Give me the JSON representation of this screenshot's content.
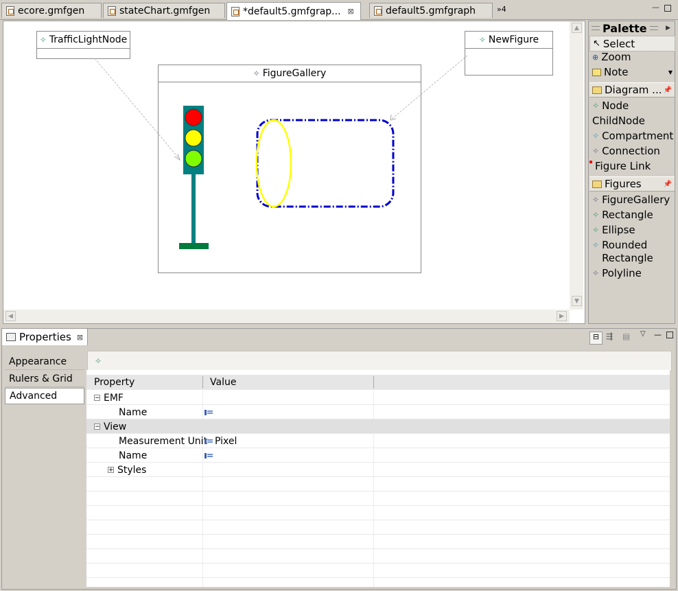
{
  "tabs": [
    {
      "label": "ecore.gmfgen"
    },
    {
      "label": "stateChart.gmfgen"
    },
    {
      "label": "*default5.gmfgrap..."
    },
    {
      "label": "default5.gmfgraph"
    }
  ],
  "overflow_count": "»4",
  "diagram": {
    "traffic_node": "TrafficLightNode",
    "new_figure": "NewFigure",
    "gallery": "FigureGallery",
    "colors": {
      "red": "#ff0000",
      "yellow": "#ffff00",
      "green": "#80ff00",
      "pole": "#008080",
      "base": "#007a3d",
      "dashed": "#0000cc",
      "ellipse": "#ffff00"
    }
  },
  "palette": {
    "title": "Palette",
    "tools": [
      {
        "label": "Select",
        "icon": "arrow-cursor-icon"
      },
      {
        "label": "Zoom",
        "icon": "magnifier-icon"
      },
      {
        "label": "Note",
        "icon": "note-icon"
      }
    ],
    "drawers": [
      {
        "label": "Diagram ...",
        "items": [
          "Node",
          "ChildNode",
          "Compartment",
          "Connection",
          "Figure Link"
        ]
      },
      {
        "label": "Figures",
        "items": [
          "FigureGallery",
          "Rectangle",
          "Ellipse",
          "Rounded Rectangle",
          "Polyline"
        ]
      }
    ]
  },
  "properties": {
    "view_title": "Properties",
    "side_tabs": [
      "Appearance",
      "Rulers & Grid",
      "Advanced"
    ],
    "header": {
      "property": "Property",
      "value": "Value"
    },
    "rows": [
      {
        "indent": 0,
        "toggle": "⊟",
        "label": "EMF",
        "value": ""
      },
      {
        "indent": 1,
        "label": "Name",
        "value": ""
      },
      {
        "indent": 0,
        "toggle": "⊟",
        "label": "View",
        "value": ""
      },
      {
        "indent": 1,
        "label": "Measurement Unit",
        "value": "Pixel"
      },
      {
        "indent": 1,
        "label": "Name",
        "value": ""
      },
      {
        "indent": 1,
        "toggle": "⊞",
        "label": "Styles",
        "value": ""
      }
    ]
  }
}
